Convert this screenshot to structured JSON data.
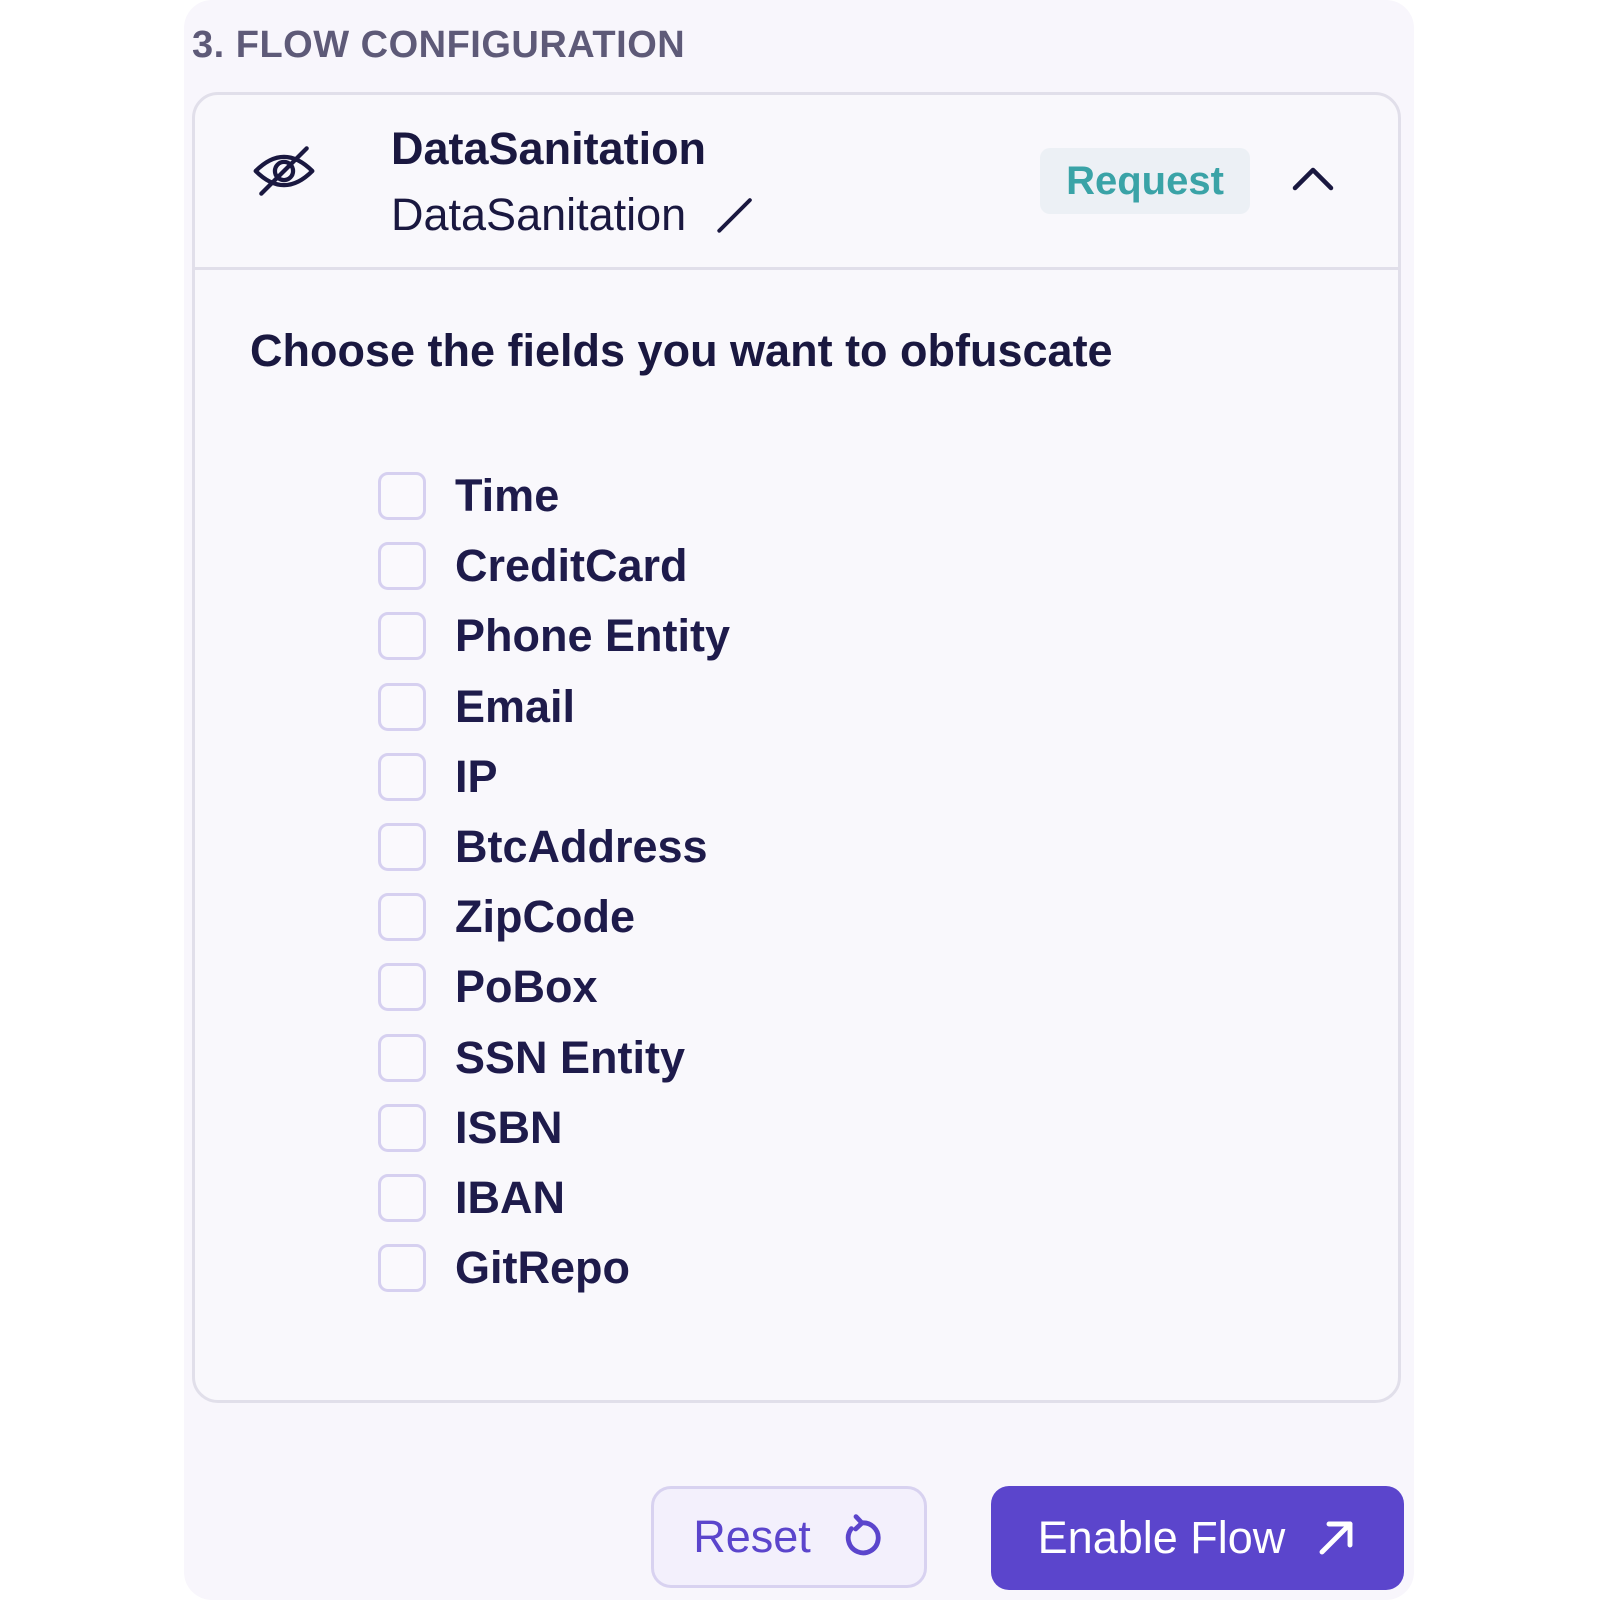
{
  "section": {
    "title": "3. FLOW CONFIGURATION"
  },
  "plugin": {
    "icon": "eye-off-icon",
    "title": "DataSanitation",
    "subtitle": "DataSanitation",
    "edit_icon": "pencil-icon",
    "badge": "Request",
    "collapse_icon": "chevron-up-icon"
  },
  "form": {
    "prompt": "Choose the fields you want to obfuscate",
    "options": [
      {
        "label": "Time",
        "checked": false
      },
      {
        "label": "CreditCard",
        "checked": false
      },
      {
        "label": "Phone Entity",
        "checked": false
      },
      {
        "label": "Email",
        "checked": false
      },
      {
        "label": "IP",
        "checked": false
      },
      {
        "label": "BtcAddress",
        "checked": false
      },
      {
        "label": "ZipCode",
        "checked": false
      },
      {
        "label": "PoBox",
        "checked": false
      },
      {
        "label": "SSN Entity",
        "checked": false
      },
      {
        "label": "ISBN",
        "checked": false
      },
      {
        "label": "IBAN",
        "checked": false
      },
      {
        "label": "GitRepo",
        "checked": false
      }
    ]
  },
  "actions": {
    "reset_label": "Reset",
    "reset_icon": "reset-icon",
    "enable_label": "Enable Flow",
    "enable_icon": "arrow-up-right-icon"
  },
  "colors": {
    "accent": "#5b45cc",
    "badge_text": "#3aa3a7",
    "badge_bg": "#ecf0f5",
    "heading_text": "#1a1840",
    "section_title": "#5e5a78",
    "panel_bg": "#f8f6fc"
  }
}
